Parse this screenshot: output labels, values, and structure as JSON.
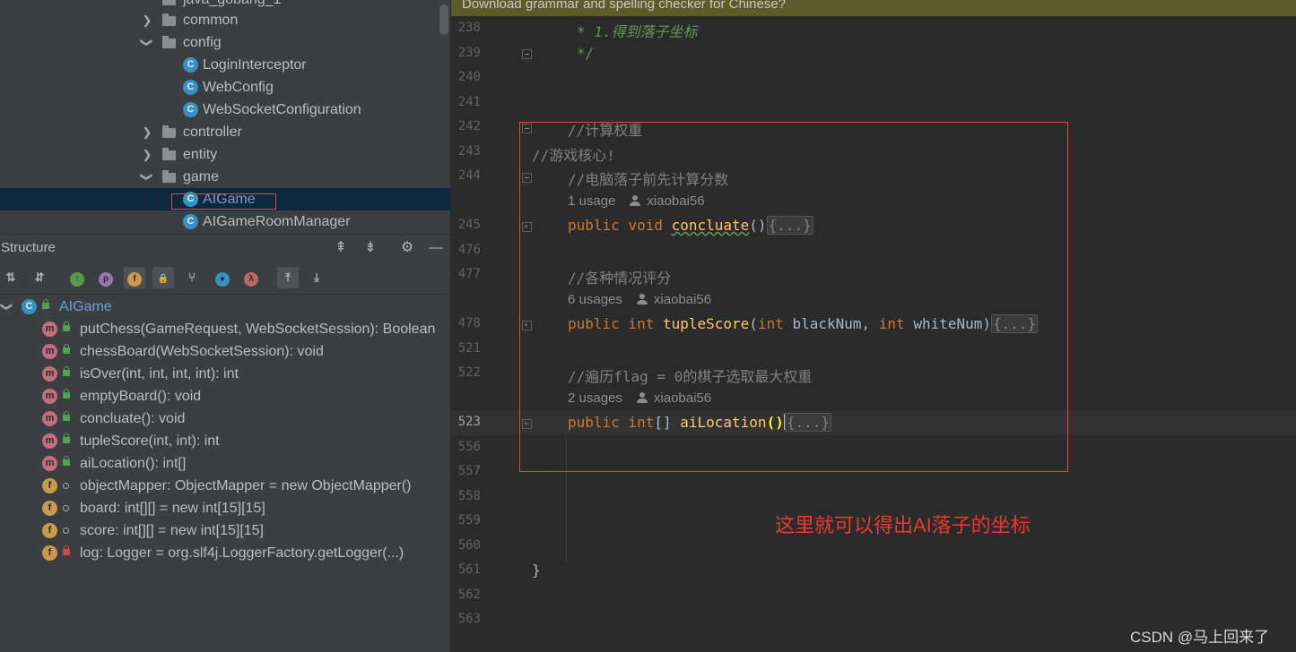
{
  "project_tree": {
    "top_partial": "java_gobang_1",
    "items": [
      {
        "label": "common",
        "kind": "folder",
        "state": "collapsed"
      },
      {
        "label": "config",
        "kind": "folder",
        "state": "expanded"
      },
      {
        "label": "LoginInterceptor",
        "kind": "class"
      },
      {
        "label": "WebConfig",
        "kind": "class"
      },
      {
        "label": "WebSocketConfiguration",
        "kind": "class"
      },
      {
        "label": "controller",
        "kind": "folder",
        "state": "collapsed"
      },
      {
        "label": "entity",
        "kind": "folder",
        "state": "collapsed"
      },
      {
        "label": "game",
        "kind": "folder",
        "state": "expanded"
      },
      {
        "label": "AIGame",
        "kind": "class",
        "selected": true
      },
      {
        "label": "AIGameRoomManager",
        "kind": "class"
      }
    ]
  },
  "structure": {
    "title": "Structure",
    "root": "AIGame",
    "members": [
      {
        "kind": "m",
        "label": "putChess(GameRequest, WebSocketSession): Boolean"
      },
      {
        "kind": "m",
        "label": "chessBoard(WebSocketSession): void"
      },
      {
        "kind": "m",
        "label": "isOver(int, int, int, int): int"
      },
      {
        "kind": "m",
        "label": "emptyBoard(): void"
      },
      {
        "kind": "m",
        "label": "concluate(): void"
      },
      {
        "kind": "m",
        "label": "tupleScore(int, int): int"
      },
      {
        "kind": "m",
        "label": "aiLocation(): int[]"
      },
      {
        "kind": "f",
        "label": "objectMapper: ObjectMapper = new ObjectMapper()"
      },
      {
        "kind": "f",
        "label": "board: int[][] = new int[15][15]"
      },
      {
        "kind": "f",
        "label": "score: int[][] = new int[15][15]"
      },
      {
        "kind": "f",
        "label": "log: Logger = org.slf4j.LoggerFactory.getLogger(...)"
      }
    ]
  },
  "editor": {
    "notice": "Download grammar and spelling checker for Chinese?",
    "line_numbers": [
      "238",
      "239",
      "240",
      "241",
      "242",
      "243",
      "244",
      "245",
      "476",
      "477",
      "478",
      "521",
      "522",
      "523",
      "556",
      "557",
      "558",
      "559",
      "560",
      "561",
      "562",
      "563"
    ],
    "current_line": "523",
    "code": {
      "l238": "* 1.得到落子坐标",
      "l239": "*/",
      "l242": "//计算权重",
      "l243": "//游戏核心!",
      "l244": "//电脑落子前先计算分数",
      "hint1_usage": "1 usage",
      "hint1_author": "xiaobai56",
      "l245_kw": "public void ",
      "l245_fn": "concluate",
      "l245_paren": "()",
      "fold_dots": "{...}",
      "l477": "//各种情况评分",
      "hint2_usage": "6 usages",
      "hint2_author": "xiaobai56",
      "l478_kw": "public int ",
      "l478_fn": "tupleScore",
      "l478_open": "(",
      "l478_t1": "int ",
      "l478_p1": "blackNum, ",
      "l478_t2": "int ",
      "l478_p2": "whiteNum)",
      "l522": "//遍历flag = 0的棋子选取最大权重",
      "hint3_usage": "2 usages",
      "hint3_author": "xiaobai56",
      "l523_kw": "public int",
      "l523_brackets": "[] ",
      "l523_fn": "aiLocation",
      "l523_paren": "()",
      "l561": "}"
    },
    "annotation": "这里就可以得出AI落子的坐标"
  },
  "watermark": "CSDN @马上回来了",
  "colors": {
    "highlight_box": "#e0464a",
    "annotation": "#e83a2e"
  }
}
